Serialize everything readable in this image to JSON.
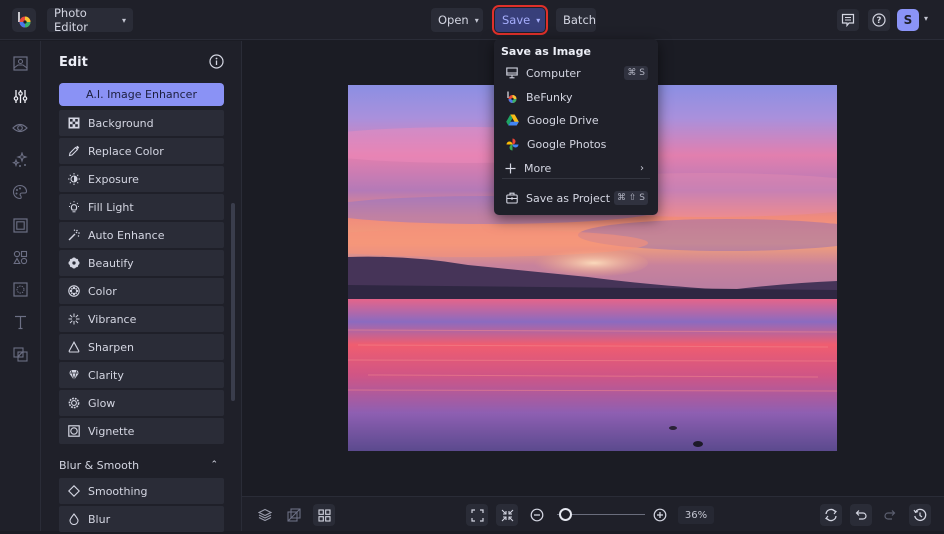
{
  "topbar": {
    "app_menu_label": "Photo Editor",
    "open_label": "Open",
    "save_label": "Save",
    "batch_label": "Batch",
    "avatar_initial": "S",
    "highlight_color": "#e0302a"
  },
  "rail": {
    "items": [
      {
        "icon": "image-icon",
        "active": false
      },
      {
        "icon": "sliders-icon",
        "active": true
      },
      {
        "icon": "eye-icon",
        "active": false
      },
      {
        "icon": "sparkle-effects-icon",
        "active": false
      },
      {
        "icon": "palette-icon",
        "active": false
      },
      {
        "icon": "frame-icon",
        "active": false
      },
      {
        "icon": "shapes-icon",
        "active": false
      },
      {
        "icon": "texture-icon",
        "active": false
      },
      {
        "icon": "text-icon",
        "active": false
      },
      {
        "icon": "overlay-icon",
        "active": false
      }
    ]
  },
  "panel": {
    "title": "Edit",
    "ai_button_label": "A.I. Image Enhancer",
    "tools": [
      {
        "label": "Background",
        "icon": "checkerboard-icon"
      },
      {
        "label": "Replace Color",
        "icon": "eyedropper-icon"
      },
      {
        "label": "Exposure",
        "icon": "exposure-icon"
      },
      {
        "label": "Fill Light",
        "icon": "lightbulb-icon"
      },
      {
        "label": "Auto Enhance",
        "icon": "magic-wand-icon"
      },
      {
        "label": "Beautify",
        "icon": "flower-icon"
      },
      {
        "label": "Color",
        "icon": "color-wheel-icon"
      },
      {
        "label": "Vibrance",
        "icon": "vibrance-icon"
      },
      {
        "label": "Sharpen",
        "icon": "triangle-icon"
      },
      {
        "label": "Clarity",
        "icon": "diamond-gem-icon"
      },
      {
        "label": "Glow",
        "icon": "glow-gear-icon"
      },
      {
        "label": "Vignette",
        "icon": "vignette-icon"
      }
    ],
    "section": {
      "title": "Blur & Smooth",
      "expanded": true,
      "tools": [
        {
          "label": "Smoothing",
          "icon": "diamond-outline-icon"
        },
        {
          "label": "Blur",
          "icon": "droplet-icon"
        }
      ]
    }
  },
  "save_menu": {
    "title": "Save as Image",
    "items": [
      {
        "label": "Computer",
        "icon": "monitor-icon",
        "shortcut": "⌘ S"
      },
      {
        "label": "BeFunky",
        "icon": "befunky-logo-icon"
      },
      {
        "label": "Google Drive",
        "icon": "google-drive-icon"
      },
      {
        "label": "Google Photos",
        "icon": "google-photos-icon"
      },
      {
        "label": "More",
        "icon": "plus-icon",
        "submenu": true
      }
    ],
    "project_item": {
      "label": "Save as Project",
      "icon": "briefcase-icon",
      "shortcut": "⌘ ⇧ S"
    }
  },
  "bottombar": {
    "zoom_percent": "36%",
    "zoom_slider_fraction": 0.05
  }
}
